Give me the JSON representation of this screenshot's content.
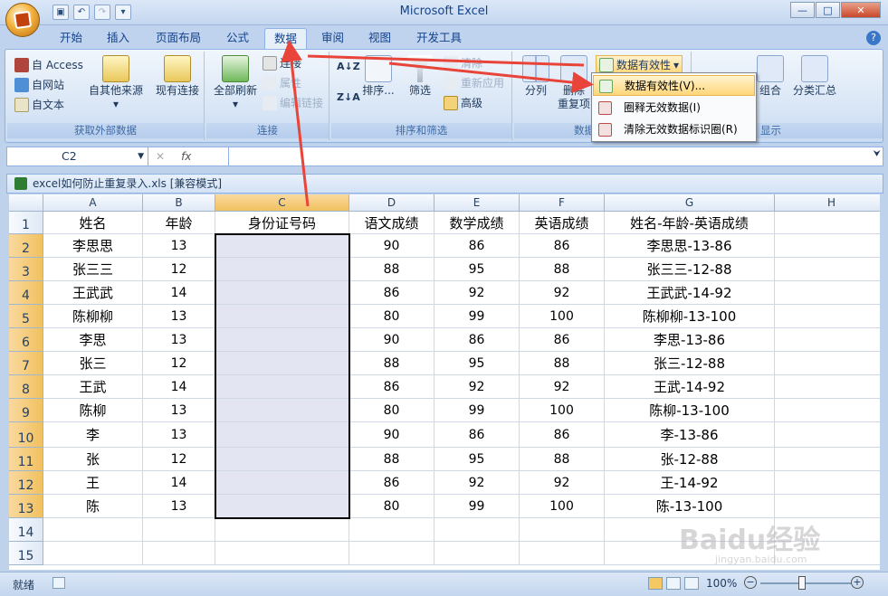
{
  "app": {
    "title": "Microsoft Excel"
  },
  "tabs": [
    "开始",
    "插入",
    "页面布局",
    "公式",
    "数据",
    "审阅",
    "视图",
    "开发工具"
  ],
  "active_tab": "数据",
  "ribbon": {
    "external": {
      "access": "自 Access",
      "web": "自网站",
      "text": "自文本",
      "other": "自其他来源",
      "existing": "现有连接",
      "label": "获取外部数据"
    },
    "connections": {
      "refresh_all": "全部刷新",
      "connect": "连接",
      "properties": "属性",
      "edit_links": "编辑链接",
      "label": "连接"
    },
    "sort": {
      "sort": "排序...",
      "filter": "筛选",
      "clear": "清除",
      "reapply": "重新应用",
      "advanced": "高级",
      "label": "排序和筛选"
    },
    "tools": {
      "split": "分列",
      "remove": "删除",
      "remove2": "重复项",
      "validation": "数据有效性",
      "label": "数据"
    },
    "outline": {
      "group": "组合",
      "subtotal": "分类汇总",
      "label": "显示"
    }
  },
  "dropdown": {
    "items": [
      "数据有效性(V)...",
      "圈释无效数据(I)",
      "清除无效数据标识圈(R)"
    ]
  },
  "namebox": "C2",
  "fx": "fx",
  "workbook": {
    "title": "excel如何防止重复录入.xls  [兼容模式]"
  },
  "columns": [
    "A",
    "B",
    "C",
    "D",
    "E",
    "F",
    "G",
    "H"
  ],
  "rows": [
    "1",
    "2",
    "3",
    "4",
    "5",
    "6",
    "7",
    "8",
    "9",
    "10",
    "11",
    "12",
    "13",
    "14",
    "15"
  ],
  "sheet": {
    "header": [
      "姓名",
      "年龄",
      "身份证号码",
      "语文成绩",
      "数学成绩",
      "英语成绩",
      "姓名-年龄-英语成绩",
      ""
    ],
    "data": [
      [
        "李思思",
        "13",
        "",
        "90",
        "86",
        "86",
        "李思思-13-86"
      ],
      [
        "张三三",
        "12",
        "",
        "88",
        "95",
        "88",
        "张三三-12-88"
      ],
      [
        "王武武",
        "14",
        "",
        "86",
        "92",
        "92",
        "王武武-14-92"
      ],
      [
        "陈柳柳",
        "13",
        "",
        "80",
        "99",
        "100",
        "陈柳柳-13-100"
      ],
      [
        "李思",
        "13",
        "",
        "90",
        "86",
        "86",
        "李思-13-86"
      ],
      [
        "张三",
        "12",
        "",
        "88",
        "95",
        "88",
        "张三-12-88"
      ],
      [
        "王武",
        "14",
        "",
        "86",
        "92",
        "92",
        "王武-14-92"
      ],
      [
        "陈柳",
        "13",
        "",
        "80",
        "99",
        "100",
        "陈柳-13-100"
      ],
      [
        "李",
        "13",
        "",
        "90",
        "86",
        "86",
        "李-13-86"
      ],
      [
        "张",
        "12",
        "",
        "88",
        "95",
        "88",
        "张-12-88"
      ],
      [
        "王",
        "14",
        "",
        "86",
        "92",
        "92",
        "王-14-92"
      ],
      [
        "陈",
        "13",
        "",
        "80",
        "99",
        "100",
        "陈-13-100"
      ]
    ]
  },
  "status": {
    "ready": "就绪",
    "zoom": "100%"
  },
  "watermark": {
    "brand": "Baidu经验",
    "url": "jingyan.baidu.com"
  }
}
